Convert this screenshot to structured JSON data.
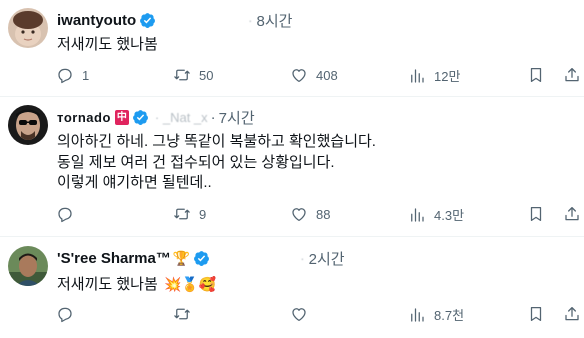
{
  "tweets": [
    {
      "display_name": "iwantyouto",
      "handle": "·",
      "time": "8시간",
      "lines": [
        "저새끼도 했나봄"
      ],
      "emojis": "",
      "reply_count": "1",
      "retweet_count": "50",
      "like_count": "408",
      "view_count": "12만"
    },
    {
      "display_name": "тornado",
      "name_badge": "中",
      "handle": "·  _Nat     _x",
      "time": "7시간",
      "lines": [
        "의아하긴 하네. 그냥 똑같이 복불하고 확인했습니다.",
        "동일 제보 여러 건 접수되어 있는 상황입니다.",
        "이렇게 얘기하면 될텐데.."
      ],
      "emojis": "",
      "reply_count": "",
      "retweet_count": "9",
      "like_count": "88",
      "view_count": "4.3만"
    },
    {
      "display_name": "'S'ree Sharma™",
      "name_badge": "🏆",
      "handle": "·",
      "time": "2시간",
      "lines": [
        "저새끼도 했나봄"
      ],
      "emojis": "💥🏅🥰",
      "reply_count": "",
      "retweet_count": "",
      "like_count": "",
      "view_count": "8.7천"
    }
  ],
  "colors": {
    "text": "#0f1419",
    "muted": "#536471",
    "verified": "#1d9bf0",
    "divider": "#eff3f4",
    "badge_red": "#e0245e"
  },
  "icons": [
    "reply-icon",
    "retweet-icon",
    "like-icon",
    "views-icon",
    "bookmark-icon",
    "share-icon",
    "verified-badge-icon"
  ]
}
